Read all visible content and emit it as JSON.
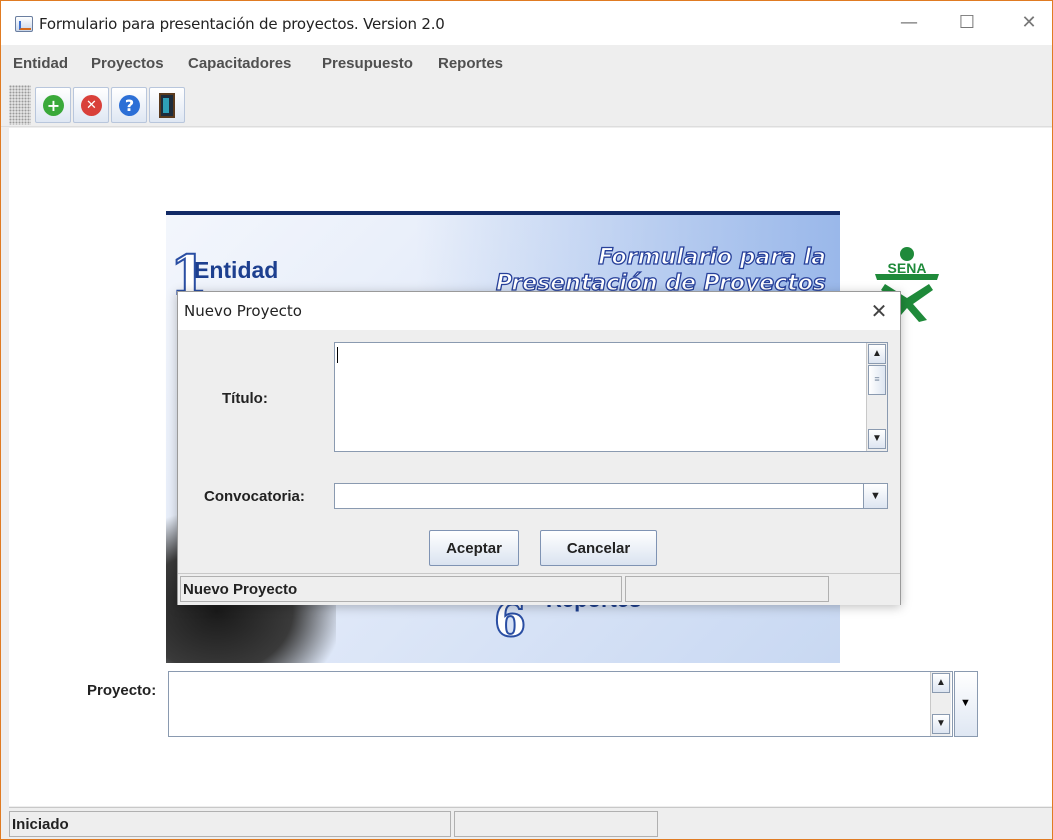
{
  "window": {
    "title": "Formulario para presentación de proyectos. Version 2.0",
    "controls": {
      "minimize": "—",
      "maximize": "☐",
      "close": "✕"
    }
  },
  "menu": {
    "items": [
      {
        "label": "Entidad"
      },
      {
        "label": "Proyectos"
      },
      {
        "label": "Capacitadores"
      },
      {
        "label": "Presupuesto"
      },
      {
        "label": "Reportes"
      }
    ]
  },
  "toolbar": {
    "buttons": [
      {
        "icon": "add-icon",
        "glyph": "+",
        "color": "#3aa93a"
      },
      {
        "icon": "delete-icon",
        "glyph": "✕",
        "color": "#d9403a"
      },
      {
        "icon": "help-icon",
        "glyph": "?",
        "color": "#2c6fd6"
      },
      {
        "icon": "exit-door-icon"
      }
    ]
  },
  "banner": {
    "num1": "1",
    "entidad": "Entidad",
    "title_line1": "Formulario para la",
    "title_line2": "Presentación de Proyectos",
    "num6": "6",
    "reportes": "Reportes"
  },
  "logo": {
    "text": "SENA",
    "color": "#1f8a3a"
  },
  "main": {
    "proyecto_label": "Proyecto:",
    "proyecto_value": ""
  },
  "statusbar": {
    "cells": [
      "Iniciado",
      "",
      ""
    ]
  },
  "dialog": {
    "title": "Nuevo Proyecto",
    "close": "✕",
    "titulo_label": "Título:",
    "titulo_value": "",
    "convocatoria_label": "Convocatoria:",
    "convocatoria_value": "",
    "accept_label": "Aceptar",
    "cancel_label": "Cancelar",
    "status": [
      "Nuevo Proyecto",
      "",
      ""
    ]
  },
  "colors": {
    "accent_border": "#e07b22",
    "banner_blue": "#1d3f8f"
  }
}
